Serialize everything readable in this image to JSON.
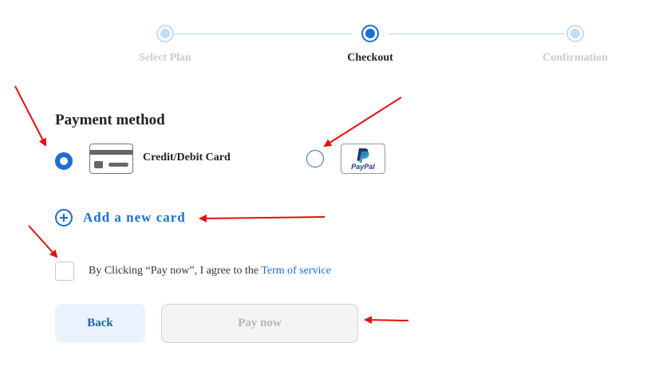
{
  "stepper": {
    "steps": [
      {
        "label": "Select Plan",
        "state": "inactive"
      },
      {
        "label": "Checkout",
        "state": "active"
      },
      {
        "label": "Confirmation",
        "state": "inactive"
      }
    ]
  },
  "payment": {
    "title": "Payment method",
    "methods": [
      {
        "label": "Credit/Debit Card",
        "icon": "credit-card-icon",
        "selected": true
      },
      {
        "label": "",
        "icon": "paypal-icon",
        "selected": false,
        "logo_text": "PayPal"
      }
    ],
    "add_card_label": "Add a new card"
  },
  "terms": {
    "prefix": "By Clicking “Pay now”, I agree to the ",
    "link": "Term of service"
  },
  "buttons": {
    "back": "Back",
    "pay": "Pay now"
  },
  "colors": {
    "accent": "#1a6fd4",
    "annotation": "#e51010",
    "disabled_text": "#b5b5b5"
  }
}
